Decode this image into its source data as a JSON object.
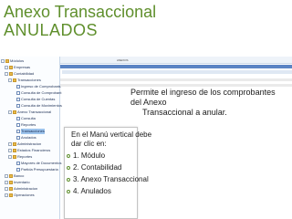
{
  "slide": {
    "title_line1": "Anexo Transaccional",
    "title_line2": "ANULADOS"
  },
  "callout": {
    "line1": "Permite el ingreso de los comprobantes del Anexo",
    "line2": "Transaccional a anular."
  },
  "instructions": {
    "intro_line1": "En el Manú vertical debe",
    "intro_line2": "dar clic en:",
    "steps": [
      "1. Módulo",
      "2. Contabilidad",
      "3. Anexo Transaccional",
      "4. Anulados"
    ]
  },
  "app": {
    "header_tag": "ANEXOS",
    "tree": [
      {
        "label": "Módulos",
        "icon": "folder-icon"
      },
      {
        "label": "Empresas",
        "icon": "folder-icon"
      },
      {
        "label": "Contabilidad",
        "icon": "folder-icon"
      },
      {
        "label": "Transacciones",
        "icon": "folder-icon"
      },
      {
        "label": "Ingreso de Comprobante",
        "icon": "document-icon"
      },
      {
        "label": "Consulta de Comprobant",
        "icon": "document-icon"
      },
      {
        "label": "Consulta de Cuentas",
        "icon": "document-icon"
      },
      {
        "label": "Consulta de Movimientos",
        "icon": "document-icon"
      },
      {
        "label": "Anexo Transaccional",
        "icon": "folder-icon"
      },
      {
        "label": "Consulta",
        "icon": "document-icon"
      },
      {
        "label": "Reportes",
        "icon": "document-icon"
      },
      {
        "label": "Transacciones",
        "icon": "document-icon"
      },
      {
        "label": "Anulados",
        "icon": "document-icon"
      },
      {
        "label": "Administracion",
        "icon": "folder-icon"
      },
      {
        "label": "Estados Financieros",
        "icon": "folder-icon"
      },
      {
        "label": "Reportes",
        "icon": "folder-icon"
      },
      {
        "label": "Mayores de Documentos",
        "icon": "document-icon"
      },
      {
        "label": "Partida Presupuestaria",
        "icon": "document-icon"
      },
      {
        "label": "Banco",
        "icon": "folder-icon"
      },
      {
        "label": "Inventario",
        "icon": "folder-icon"
      },
      {
        "label": "Administracion",
        "icon": "folder-icon"
      },
      {
        "label": "Operaciones",
        "icon": "folder-icon"
      }
    ]
  },
  "colors": {
    "title": "#5f8f2c",
    "selected_row": "#9cc3ec",
    "header_bar": "#5b84c4"
  }
}
